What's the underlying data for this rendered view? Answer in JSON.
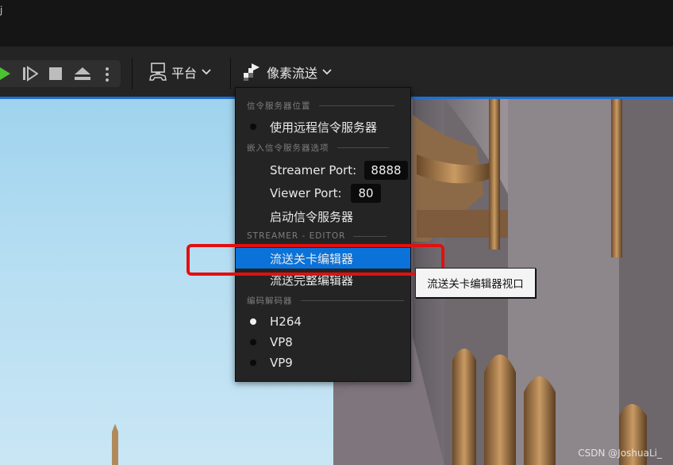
{
  "window": {
    "title_fragment": "j"
  },
  "toolbar": {
    "play_icon": "play-icon",
    "step_icon": "step-forward-icon",
    "stop_icon": "stop-icon",
    "eject_icon": "eject-icon",
    "more_icon": "vertical-dots-icon",
    "platform_label": "平台",
    "pixel_streaming_label": "像素流送",
    "accent_color": "#1f6fd1",
    "play_color": "#4cc232"
  },
  "menu": {
    "section_signalling_location": "信令服务器位置",
    "use_remote_signalling": "使用远程信令服务器",
    "section_embedded_options": "嵌入信令服务器选项",
    "streamer_port_label": "Streamer Port:",
    "streamer_port_value": "8888",
    "viewer_port_label": "Viewer Port:",
    "viewer_port_value": "80",
    "start_signalling": "启动信令服务器",
    "section_streamer_editor": "STREAMER - EDITOR",
    "stream_level_editor": "流送关卡编辑器",
    "stream_full_editor": "流送完整编辑器",
    "section_codec": "编码解码器",
    "codecs": [
      {
        "label": "H264",
        "selected": true
      },
      {
        "label": "VP8",
        "selected": false
      },
      {
        "label": "VP9",
        "selected": false
      }
    ],
    "highlight_color": "#0a72d8"
  },
  "tooltip": {
    "text": "流送关卡编辑器视口"
  },
  "annotation": {
    "box_color": "#e21010"
  },
  "watermark": {
    "text": "CSDN @JoshuaLi_"
  }
}
